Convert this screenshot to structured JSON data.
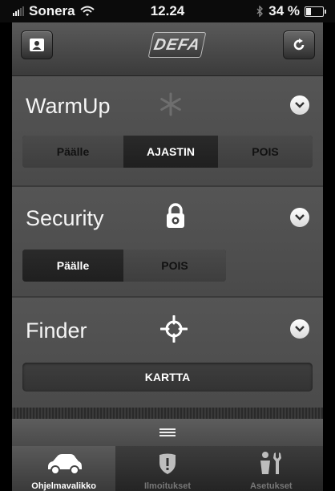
{
  "status_bar": {
    "carrier": "Sonera",
    "time": "12.24",
    "battery": "34 %",
    "battery_level": 0.34
  },
  "header": {
    "logo": "DEFA",
    "left_icon": "profile-card-icon",
    "right_icon": "refresh-icon"
  },
  "sections": {
    "warmup": {
      "title": "WarmUp",
      "icon": "snowflake-icon",
      "options": [
        "Päälle",
        "AJASTIN",
        "POIS"
      ],
      "selected": "AJASTIN"
    },
    "security": {
      "title": "Security",
      "icon": "padlock-icon",
      "options": [
        "Päälle",
        "POIS"
      ],
      "selected": "Päälle"
    },
    "finder": {
      "title": "Finder",
      "icon": "crosshair-icon",
      "button": "KARTTA"
    }
  },
  "tabs": [
    {
      "label": "Ohjelmavalikko",
      "icon": "car-icon",
      "active": true
    },
    {
      "label": "Ilmoitukset",
      "icon": "shield-alert-icon",
      "active": false
    },
    {
      "label": "Asetukset",
      "icon": "tools-icon",
      "active": false
    }
  ],
  "colors": {
    "background": "#000000",
    "panel": "#505050",
    "active_segment": "#222222"
  }
}
